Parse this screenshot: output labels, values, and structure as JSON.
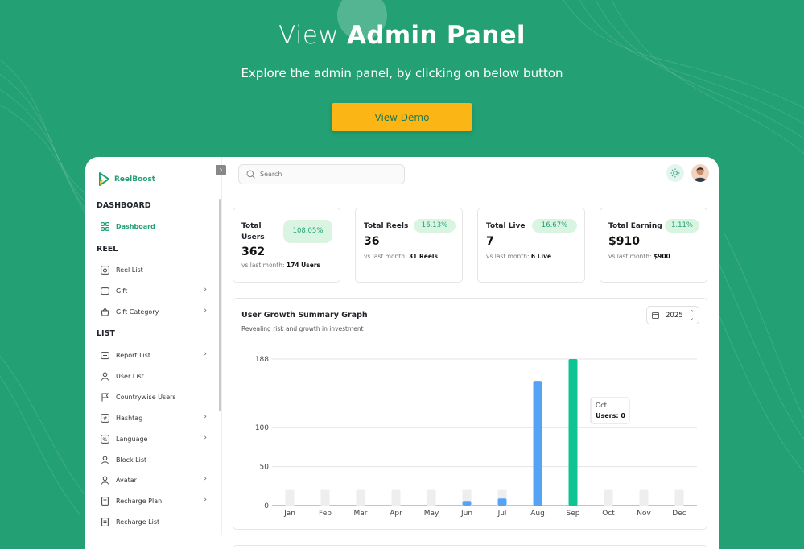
{
  "hero": {
    "title_light": "View ",
    "title_bold": "Admin Panel",
    "subtitle": "Explore the admin panel, by clicking on below button",
    "button_label": "View Demo"
  },
  "app": {
    "brand": "ReelBoost",
    "sidebar": {
      "sections": [
        {
          "label": "DASHBOARD"
        },
        {
          "label": "REEL"
        },
        {
          "label": "LIST"
        }
      ],
      "items": [
        {
          "label": "Dashboard",
          "icon": "grid-icon",
          "active": true,
          "chevron": false
        },
        {
          "label": "Reel List",
          "icon": "reel-icon",
          "chevron": false
        },
        {
          "label": "Gift",
          "icon": "gift-icon",
          "chevron": true
        },
        {
          "label": "Gift Category",
          "icon": "basket-icon",
          "chevron": true
        },
        {
          "label": "Report List",
          "icon": "report-icon",
          "chevron": true
        },
        {
          "label": "User List",
          "icon": "user-icon",
          "chevron": false
        },
        {
          "label": "Countrywise Users",
          "icon": "flag-icon",
          "chevron": false
        },
        {
          "label": "Hashtag",
          "icon": "hashtag-icon",
          "chevron": true
        },
        {
          "label": "Language",
          "icon": "language-icon",
          "chevron": true
        },
        {
          "label": "Block List",
          "icon": "block-user-icon",
          "chevron": false
        },
        {
          "label": "Avatar",
          "icon": "avatar-icon",
          "chevron": true
        },
        {
          "label": "Recharge Plan",
          "icon": "recharge-icon",
          "chevron": true
        },
        {
          "label": "Recharge List",
          "icon": "recharge-list-icon",
          "chevron": false
        }
      ]
    },
    "search": {
      "placeholder": "Search"
    },
    "cards": [
      {
        "title": "Total Users",
        "value": "362",
        "change": "108.05%",
        "vs_label": "vs last month:",
        "vs_value": "174 Users"
      },
      {
        "title": "Total Reels",
        "value": "36",
        "change": "16.13%",
        "vs_label": "vs last month:",
        "vs_value": "31 Reels"
      },
      {
        "title": "Total Live",
        "value": "7",
        "change": "16.67%",
        "vs_label": "vs last month:",
        "vs_value": "6 Live"
      },
      {
        "title": "Total Earning",
        "value": "$910",
        "change": "1.11%",
        "vs_label": "vs last month:",
        "vs_value": "$900"
      }
    ],
    "graph": {
      "title": "User Growth Summary Graph",
      "subtitle": "Revealing risk and growth in investment",
      "year": "2025",
      "tooltip": {
        "month": "Oct",
        "label": "Users:",
        "value": "0"
      }
    }
  },
  "colors": {
    "brand": "#23a074",
    "accent_button": "#fbb615",
    "bar_blue": "#56a3f5",
    "bar_green": "#0fc494",
    "bar_empty": "#eeeeee"
  },
  "chart_data": {
    "type": "bar",
    "categories": [
      "Jan",
      "Feb",
      "Mar",
      "Apr",
      "May",
      "Jun",
      "Jul",
      "Aug",
      "Sep",
      "Oct",
      "Nov",
      "Dec"
    ],
    "values": [
      0,
      0,
      0,
      0,
      0,
      6,
      9,
      160,
      188,
      0,
      0,
      0
    ],
    "highlight": "Sep",
    "yticks": [
      0,
      50,
      100,
      188
    ],
    "ylim": [
      0,
      188
    ],
    "grid": true,
    "title": "User Growth Summary Graph"
  }
}
